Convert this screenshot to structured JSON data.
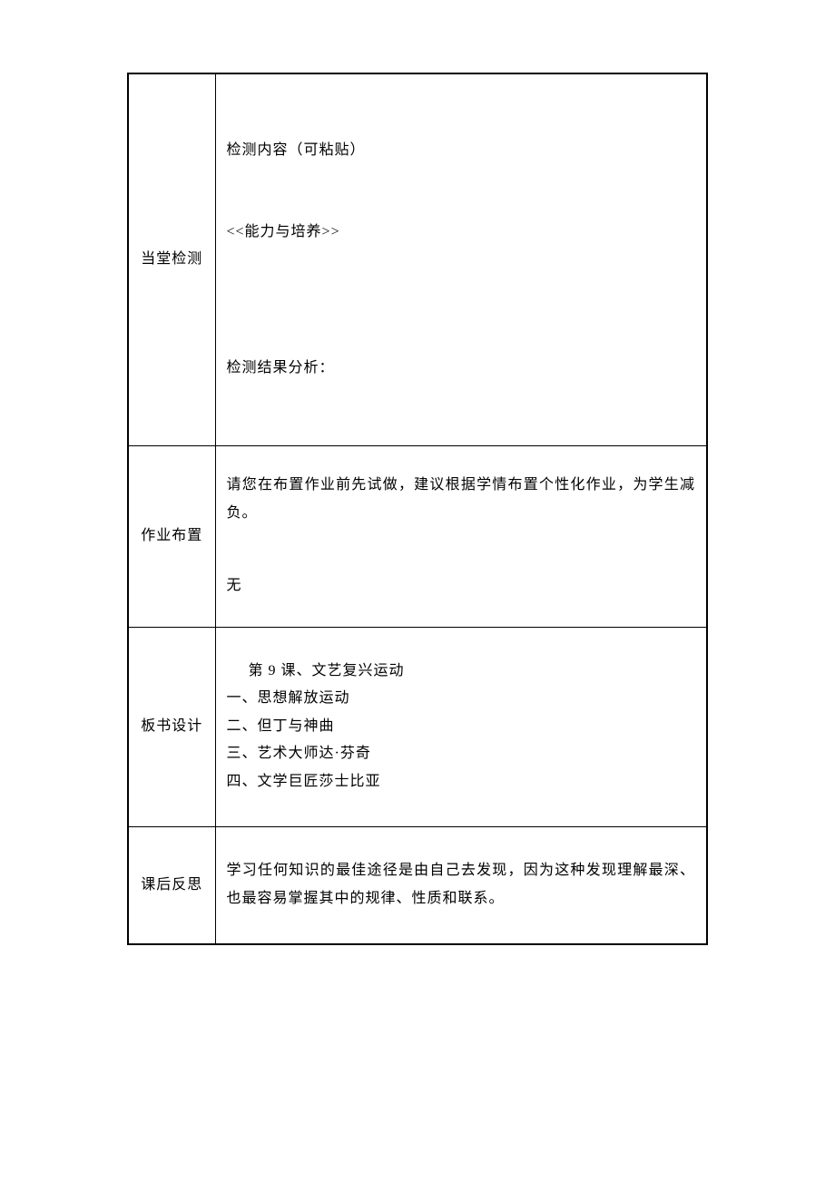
{
  "rows": {
    "r1": {
      "label": "当堂检测",
      "line1": "检测内容（可粘贴）",
      "line2": "<<能力与培养>>",
      "line3": "检测结果分析："
    },
    "r2": {
      "label": "作业布置",
      "line1": "请您在布置作业前先试做，建议根据学情布置个性化作业，为学生减负。",
      "line2": "无"
    },
    "r3": {
      "label": "板书设计",
      "title": "第 9 课、文艺复兴运动",
      "item1": "一、思想解放运动",
      "item2": "二、但丁与神曲",
      "item3": "三、艺术大师达·芬奇",
      "item4": "四、文学巨匠莎士比亚"
    },
    "r4": {
      "label": "课后反思",
      "text": "学习任何知识的最佳途径是由自己去发现，因为这种发现理解最深、也最容易掌握其中的规律、性质和联系。"
    }
  }
}
